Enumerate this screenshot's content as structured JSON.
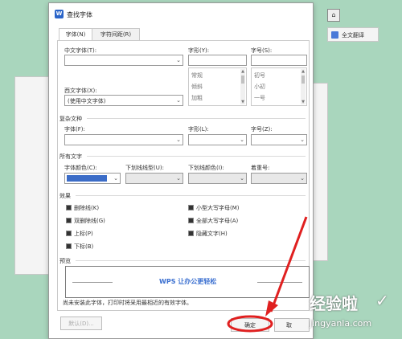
{
  "window": {
    "title": "查找字体",
    "icon": "W"
  },
  "tabs": [
    {
      "label": "字体(N)",
      "active": true
    },
    {
      "label": "字符间距(R)",
      "active": false
    }
  ],
  "chinese_font": {
    "label": "中文字体(T):",
    "value": ""
  },
  "style": {
    "label": "字形(Y):",
    "value": "",
    "options": [
      "常规",
      "倾斜",
      "加粗"
    ]
  },
  "size": {
    "label": "字号(S):",
    "value": "",
    "options": [
      "初号",
      "小初",
      "一号"
    ]
  },
  "western_font": {
    "label": "西文字体(X):",
    "value": "(使用中文字体)"
  },
  "complex": {
    "section": "复杂文种",
    "font_label": "字体(F):",
    "style_label": "字形(L):",
    "size_label": "字号(Z):"
  },
  "all_text": {
    "section": "所有文字",
    "color_label": "字体颜色(C):",
    "color_value": "#3b6cc7",
    "underline_label": "下划线线型(U):",
    "underline_color_label": "下划线颜色(I):",
    "emphasis_label": "着重号:"
  },
  "effects": {
    "section": "效果",
    "left": [
      "删除线(K)",
      "双删除线(G)",
      "上标(P)",
      "下标(B)"
    ],
    "right": [
      "小型大写字母(M)",
      "全部大写字母(A)",
      "隐藏文字(H)"
    ]
  },
  "preview": {
    "section": "预览",
    "text": "WPS 让办公更轻松",
    "text_color": "#3a6fd0"
  },
  "note": "尚未安装此字体，打印时将采用最相近的有效字体。",
  "buttons": {
    "default": "默认(D)...",
    "ok": "确定",
    "cancel": "取"
  },
  "right_pane": {
    "translate": "全文翻译"
  },
  "watermark": {
    "text": "经验啦",
    "url": "jingyanla.com"
  },
  "colors": {
    "accent": "#2b65c9",
    "annotation": "#e02020",
    "background": "#a9d6bd"
  }
}
